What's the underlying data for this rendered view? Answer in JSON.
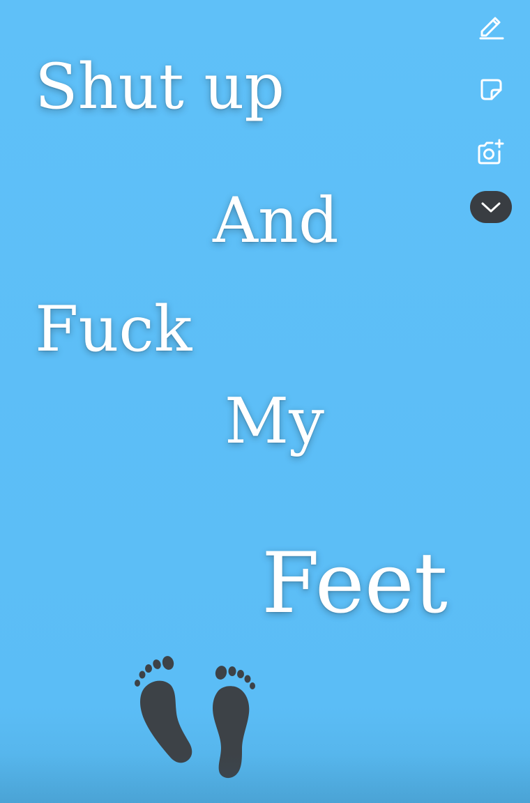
{
  "story": {
    "background_color": "#5dbff7",
    "text_color": "#ffffff",
    "lines": [
      "Shut up",
      "And",
      "Fuck",
      "My",
      "Feet"
    ],
    "graphic": "footprints-icon",
    "graphic_color": "#3d4247"
  },
  "toolbar": {
    "tools": [
      {
        "icon": "pencil-icon"
      },
      {
        "icon": "sticker-icon"
      },
      {
        "icon": "camera-add-icon"
      },
      {
        "icon": "chevron-down-icon",
        "background": "#393d42"
      }
    ]
  }
}
